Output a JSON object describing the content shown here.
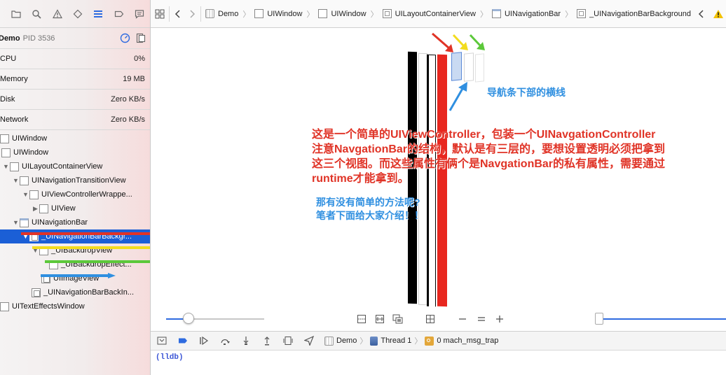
{
  "process": {
    "name": "Demo",
    "pid": "PID 3536"
  },
  "gauges": [
    {
      "label": "CPU",
      "value": "0%"
    },
    {
      "label": "Memory",
      "value": "19 MB"
    },
    {
      "label": "Disk",
      "value": "Zero KB/s"
    },
    {
      "label": "Network",
      "value": "Zero KB/s"
    }
  ],
  "tree": [
    {
      "label": "UIWindow"
    },
    {
      "label": "UIWindow"
    },
    {
      "label": "UILayoutContainerView"
    },
    {
      "label": "UINavigationTransitionView"
    },
    {
      "label": "UIViewControllerWrappe..."
    },
    {
      "label": "UIView"
    },
    {
      "label": "UINavigationBar"
    },
    {
      "label": "_UINavigationBarBackgr..."
    },
    {
      "label": "_UIBackdropView"
    },
    {
      "label": "_UIBackdropEffect..."
    },
    {
      "label": "UIImageView"
    },
    {
      "label": "_UINavigationBarBackIn..."
    },
    {
      "label": "UITextEffectsWindow"
    }
  ],
  "breadcrumbs": [
    "Demo",
    "UIWindow",
    "UIWindow",
    "UILayoutContainerView",
    "UINavigationBar",
    "_UINavigationBarBackground"
  ],
  "annotations": {
    "caption_line": "导航条下部的横线",
    "red_text": [
      "这是一个简单的UIViewController，包装一个UINavgationController",
      "注意NavgationBar的结构，默认是有三层的，要想设置透明必须把拿到",
      "这三个视图。而这些属性有俩个是NavgationBar的私有属性，需要通过",
      "runtime才能拿到。"
    ],
    "blue_text": [
      "那有没有简单的方法呢?",
      "笔者下面给大家介绍！！"
    ]
  },
  "debug": {
    "process": "Demo",
    "thread": "Thread 1",
    "frame": "0 mach_msg_trap"
  },
  "console": {
    "prompt": "(lldb)"
  },
  "colors": {
    "selection": "#1b5fd6",
    "accent": "#2e6be0",
    "annotation_red": "#e03326",
    "annotation_blue": "#2f8fe0",
    "arrow_yellow": "#f2dc1e",
    "arrow_green": "#5cc83a"
  }
}
